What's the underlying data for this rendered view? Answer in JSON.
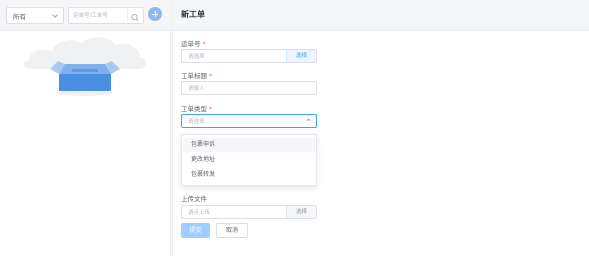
{
  "sidebar": {
    "filter": {
      "selected": "所有"
    },
    "search": {
      "placeholder": "运单号/工单号"
    }
  },
  "form": {
    "title": "新工单",
    "waybill": {
      "label": "运单号",
      "placeholder": "请选择",
      "button": "选择"
    },
    "ticket_title": {
      "label": "工单标题",
      "placeholder": "请输入"
    },
    "ticket_type": {
      "label": "工单类型",
      "placeholder": "请选择",
      "options": [
        "包裹申诉",
        "更改地址",
        "包裹转发"
      ]
    },
    "upload": {
      "label": "上传文件",
      "placeholder": "请点上传",
      "button": "选择"
    },
    "submit": "提交",
    "cancel": "取消"
  },
  "colors": {
    "primary": "#409eff",
    "primary_light": "#a0cfff",
    "required": "#f56c6c",
    "empty_box": "#4a90e2"
  }
}
